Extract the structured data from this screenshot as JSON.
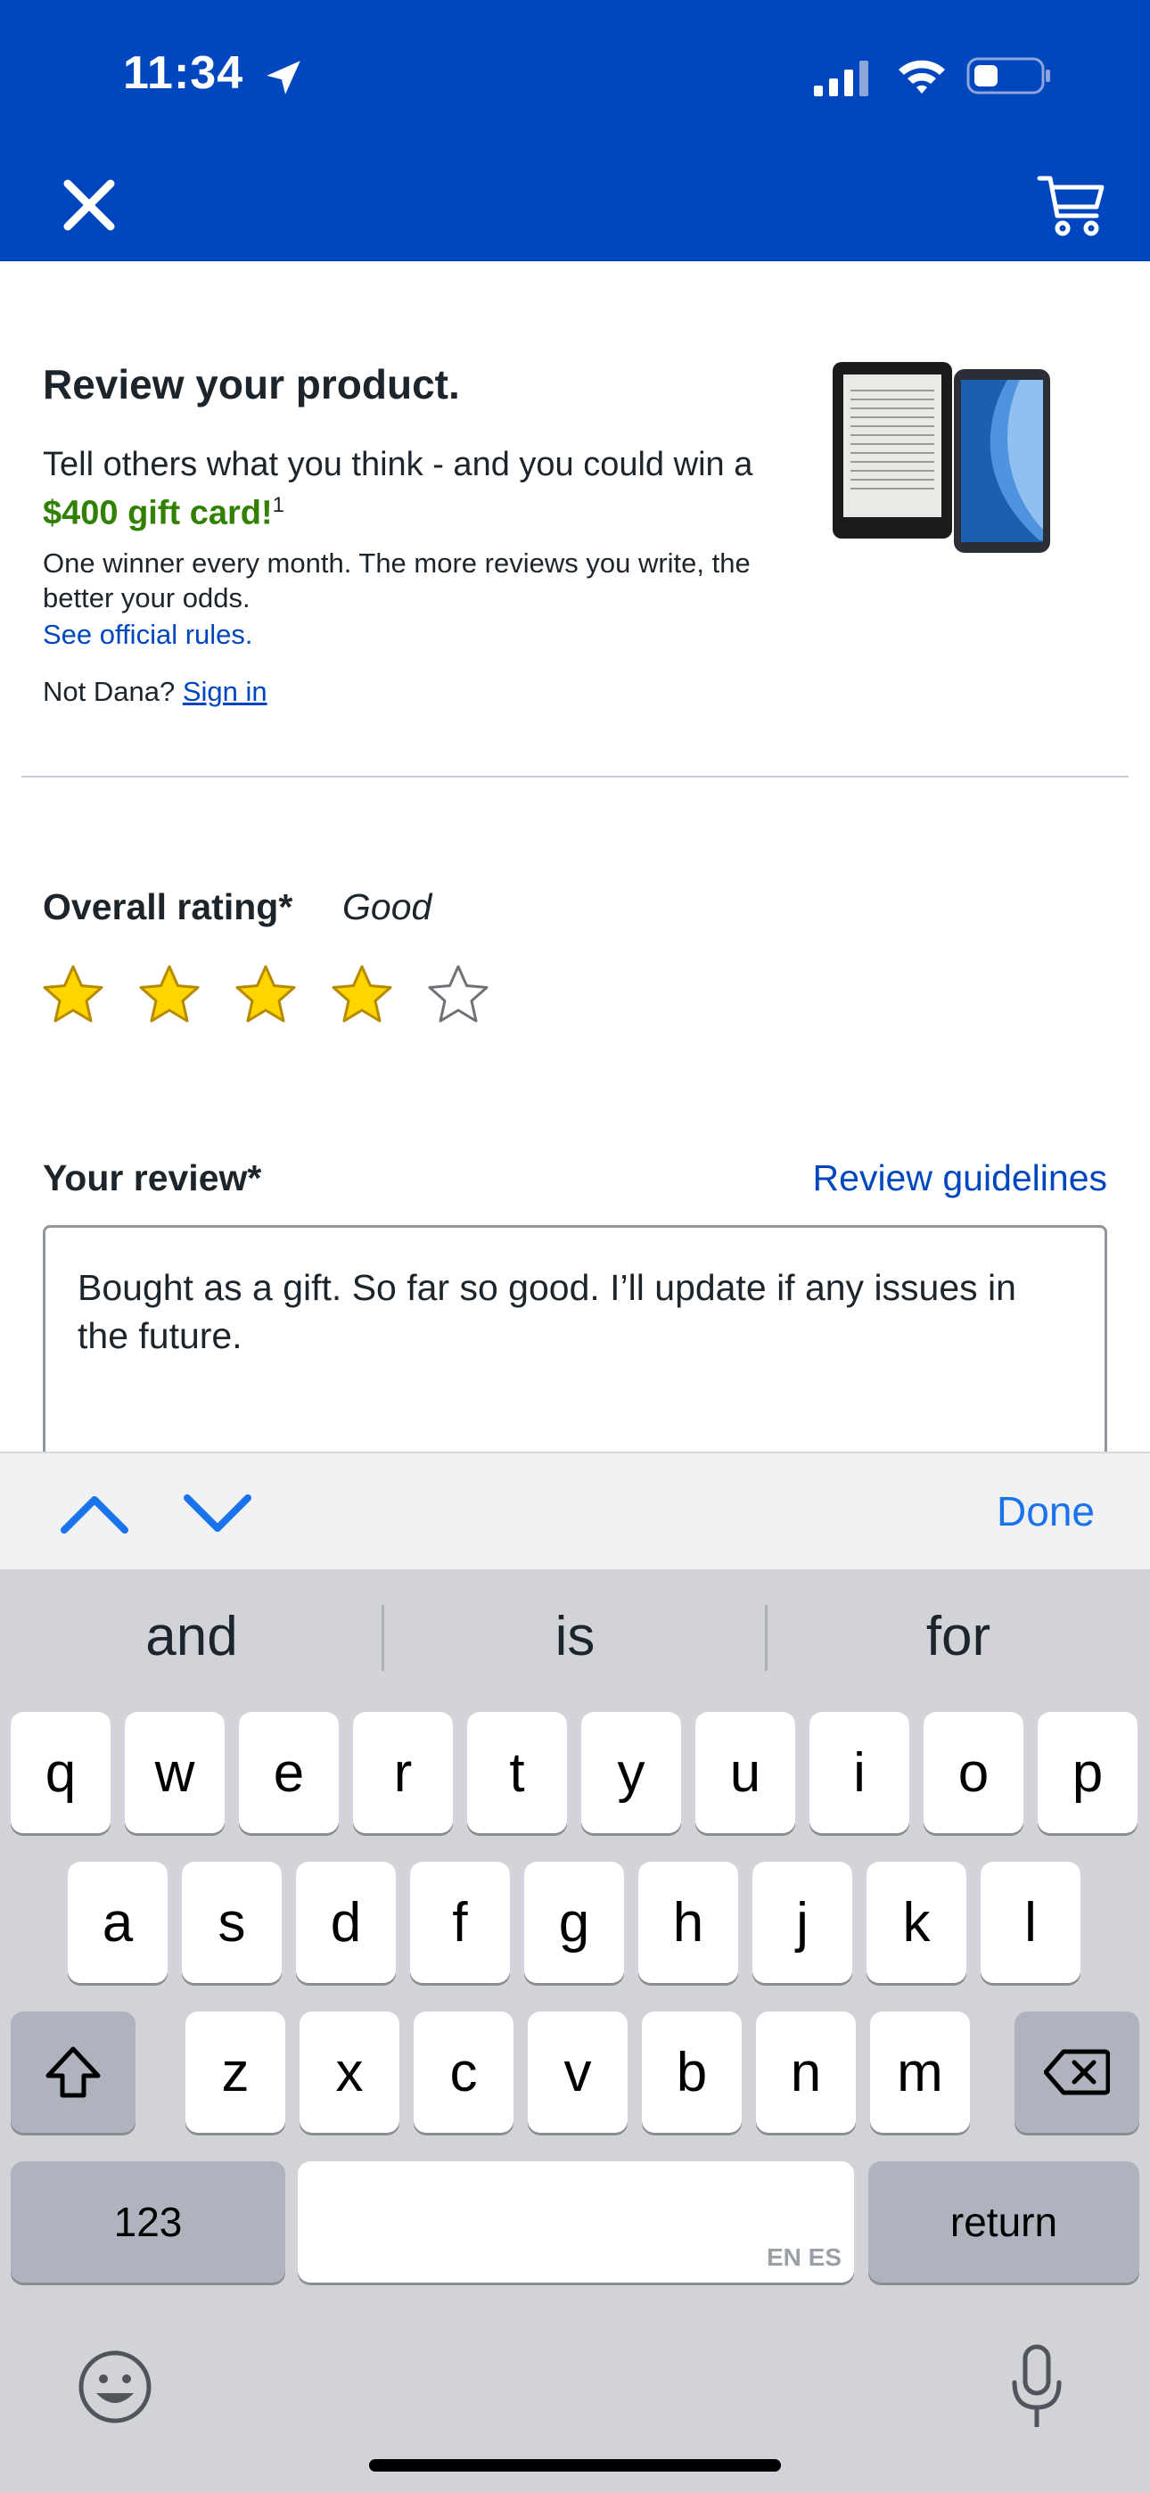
{
  "status": {
    "time": "11:34"
  },
  "header": {
    "close_icon": "close-icon",
    "cart_icon": "cart-icon"
  },
  "review_header": {
    "title": "Review your product.",
    "subtitle_pre": "Tell others what you think - and you could win a ",
    "gift": "$400 gift card!",
    "gift_sup": "1",
    "note": "One winner every month. The more reviews you write, the better your odds.",
    "rules_link": "See official rules.",
    "not_user": "Not Dana?",
    "sign_in": "Sign in"
  },
  "rating": {
    "label": "Overall rating*",
    "value_text": "Good",
    "stars_filled": 4,
    "stars_total": 5
  },
  "review": {
    "label": "Your review*",
    "guidelines": "Review guidelines",
    "text": "Bought as a gift. So far so good. I’ll update if any issues in the future."
  },
  "accessory": {
    "done": "Done"
  },
  "keyboard": {
    "suggestions": [
      "and",
      "is",
      "for"
    ],
    "row1": [
      "q",
      "w",
      "e",
      "r",
      "t",
      "y",
      "u",
      "i",
      "o",
      "p"
    ],
    "row2": [
      "a",
      "s",
      "d",
      "f",
      "g",
      "h",
      "j",
      "k",
      "l"
    ],
    "row3": [
      "z",
      "x",
      "c",
      "v",
      "b",
      "n",
      "m"
    ],
    "numbers": "123",
    "return": "return",
    "space_lang": "EN ES"
  },
  "colors": {
    "brand": "#0046be",
    "gift": "#318000",
    "star": "#ffd500",
    "link": "#0046be"
  }
}
